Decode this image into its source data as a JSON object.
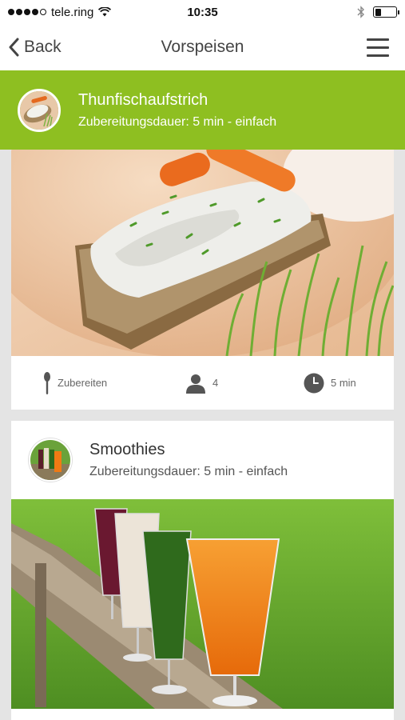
{
  "status": {
    "carrier": "tele.ring",
    "time": "10:35",
    "signal_bars_filled": 4,
    "signal_bars_total": 5,
    "battery_level": 0.3
  },
  "nav": {
    "back_label": "Back",
    "title": "Vorspeisen"
  },
  "recipes": [
    {
      "title": "Thunfischaufstrich",
      "subtitle": "Zubereitungsdauer: 5 min - einfach",
      "prep_label": "Zubereiten",
      "servings": "4",
      "time": "5 min"
    },
    {
      "title": "Smoothies",
      "subtitle": "Zubereitungsdauer: 5 min - einfach"
    }
  ],
  "icons": {
    "back": "chevron-left-icon",
    "menu": "hamburger-menu-icon",
    "prep": "spoon-icon",
    "servings": "person-icon",
    "time": "clock-icon"
  },
  "colors": {
    "accent": "#8ebf21",
    "background": "#e4e4e4"
  }
}
